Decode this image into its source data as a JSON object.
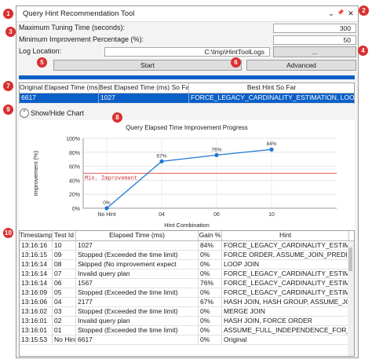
{
  "window": {
    "title": "Query Hint Recommendation Tool",
    "controls": {
      "minimize": "⌄",
      "pin": "📌",
      "close": "✕"
    }
  },
  "badges": [
    "1",
    "2",
    "3",
    "4",
    "5",
    "6",
    "7",
    "8",
    "9",
    "10"
  ],
  "settings": {
    "max_tuning_label": "Maximum Tuning Time (seconds):",
    "max_tuning_value": "300",
    "min_improvement_label": "Minimum Improvement Percentage (%):",
    "min_improvement_value": "50",
    "log_location_label": "Log Location:",
    "log_location_value": "C:\\tmp\\HintToolLogs",
    "browse_label": "..."
  },
  "buttons": {
    "start": "Start",
    "advanced": "Advanced"
  },
  "summary": {
    "headers": [
      "Original Elapsed Time (ms)",
      "Best Elapsed Time (ms) So Far",
      "Best Hint So Far"
    ],
    "row": [
      "6617",
      "1027",
      "FORCE_LEGACY_CARDINALITY_ESTIMATION, LOOP JOIN"
    ]
  },
  "toggle": {
    "icon": "^",
    "label": "Show/Hide Chart"
  },
  "chart_data": {
    "type": "line",
    "title": "Query Elapsed Time Improvement Progress",
    "xlabel": "Hint Combination",
    "ylabel": "Improvement (%)",
    "categories": [
      "No Hint",
      "04",
      "06",
      "10"
    ],
    "values": [
      0,
      67,
      76,
      84
    ],
    "data_labels": [
      "0%",
      "67%",
      "76%",
      "84%"
    ],
    "ylim": [
      0,
      100
    ],
    "y_ticks": [
      "0%",
      "20%",
      "40%",
      "60%",
      "80%",
      "100%"
    ],
    "threshold": {
      "value": 50,
      "label": "Min. Improvement",
      "color": "#e06060"
    },
    "series_color": "#1f77d4",
    "grid": true
  },
  "log": {
    "headers": [
      "Timestamp",
      "Test Id",
      "Elapsed Time (ms)",
      "Gain %",
      "Hint"
    ],
    "rows": [
      [
        "13:16:16",
        "10",
        "1027",
        "84%",
        "FORCE_LEGACY_CARDINALITY_ESTIMATION, LOOP"
      ],
      [
        "13:16:15",
        "09",
        "Stopped (Exceeded the time limit)",
        "0%",
        "FORCE ORDER,  ASSUME_JOIN_PREDICATE_DEPEND"
      ],
      [
        "13:16:14",
        "08",
        "Skipped (No improvement expect",
        "0%",
        "LOOP JOIN"
      ],
      [
        "13:16:14",
        "07",
        "Invalid query plan",
        "0%",
        "FORCE_LEGACY_CARDINALITY_ESTIMATION, FORCE"
      ],
      [
        "13:16:14",
        "06",
        "1567",
        "76%",
        "FORCE_LEGACY_CARDINALITY_ESTIMATION, FORCE"
      ],
      [
        "13:16:09",
        "05",
        "Stopped (Exceeded the time limit)",
        "0%",
        "FORCE_LEGACY_CARDINALITY_ESTIMATION, FORCE"
      ],
      [
        "13:16:06",
        "04",
        "2177",
        "67%",
        "HASH JOIN, HASH GROUP,  ASSUME_JOIN_PREDIC"
      ],
      [
        "13:16:02",
        "03",
        "Stopped (Exceeded the time limit)",
        "0%",
        "MERGE JOIN"
      ],
      [
        "13:16:01",
        "02",
        "Invalid query plan",
        "0%",
        "HASH JOIN, FORCE ORDER"
      ],
      [
        "13:16:01",
        "01",
        "Stopped (Exceeded the time limit)",
        "0%",
        "ASSUME_FULL_INDEPENDENCE_FOR_FILTER_ESTIMA"
      ],
      [
        "13:15:53",
        "No Hint",
        "6617",
        "0%",
        "Original"
      ]
    ]
  }
}
